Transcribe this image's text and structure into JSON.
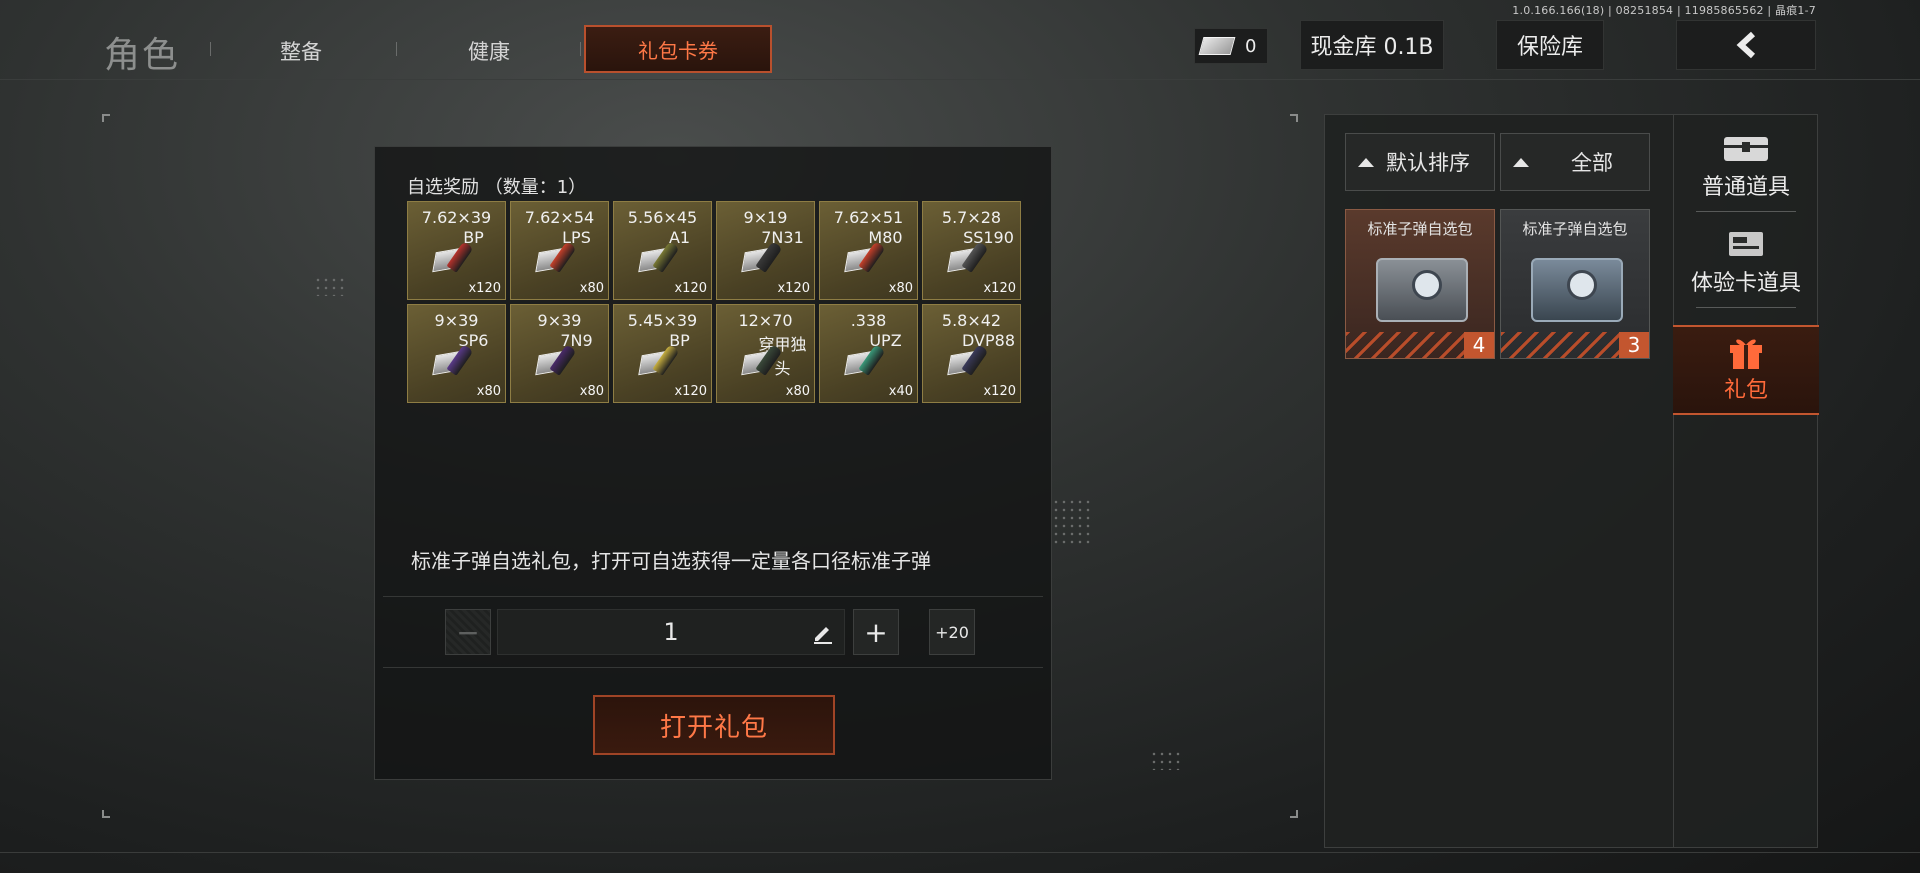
{
  "build_info": "1.0.166.166(18) | 08251854 | 11985865562 | 晶痕1-7",
  "header": {
    "main_tab": "角色",
    "tabs": [
      "整备",
      "健康"
    ],
    "active_tab": "礼包卡券",
    "cash_count": "0",
    "cash_vault": "现金库 0.1B",
    "safe": "保险库"
  },
  "reward": {
    "title": "自选奖励 （数量：1）",
    "items": [
      {
        "caliber": "7.62×39",
        "variant": "BP",
        "qty": "x120",
        "color": "#b8322c"
      },
      {
        "caliber": "7.62×54",
        "variant": "LPS",
        "qty": "x80",
        "color": "#c8402a"
      },
      {
        "caliber": "5.56×45",
        "variant": "A1",
        "qty": "x120",
        "color": "#7a7a34"
      },
      {
        "caliber": "9×19",
        "variant": "7N31",
        "qty": "x120",
        "color": "#3a3a3a"
      },
      {
        "caliber": "7.62×51",
        "variant": "M80",
        "qty": "x80",
        "color": "#c8402a"
      },
      {
        "caliber": "5.7×28",
        "variant": "SS190",
        "qty": "x120",
        "color": "#555555"
      },
      {
        "caliber": "9×39",
        "variant": "SP6",
        "qty": "x80",
        "color": "#5a3a8a"
      },
      {
        "caliber": "9×39",
        "variant": "7N9",
        "qty": "x80",
        "color": "#4a2a6a"
      },
      {
        "caliber": "5.45×39",
        "variant": "BP",
        "qty": "x120",
        "color": "#c8b040"
      },
      {
        "caliber": "12×70",
        "variant": "穿甲独头",
        "qty": "x80",
        "color": "#3a4a3a"
      },
      {
        "caliber": ".338",
        "variant": "UPZ",
        "qty": "x40",
        "color": "#3a9a7a"
      },
      {
        "caliber": "5.8×42",
        "variant": "DVP88",
        "qty": "x120",
        "color": "#3a3a5a"
      }
    ],
    "description": "标准子弹自选礼包，打开可自选获得一定量各口径标准子弹",
    "quantity": "1",
    "minus": "−",
    "plus": "+",
    "plus20": "+20",
    "open_button": "打开礼包"
  },
  "inventory": {
    "sort_label": "默认排序",
    "filter_label": "全部",
    "cards": [
      {
        "name": "标准子弹自选包",
        "count": "4"
      },
      {
        "name": "标准子弹自选包",
        "count": "3"
      }
    ],
    "categories": [
      {
        "label": "普通道具",
        "icon": "chest-icon"
      },
      {
        "label": "体验卡道具",
        "icon": "card-icon"
      },
      {
        "label": "礼包",
        "icon": "gift-icon"
      }
    ],
    "accent_color": "#c3562f"
  }
}
